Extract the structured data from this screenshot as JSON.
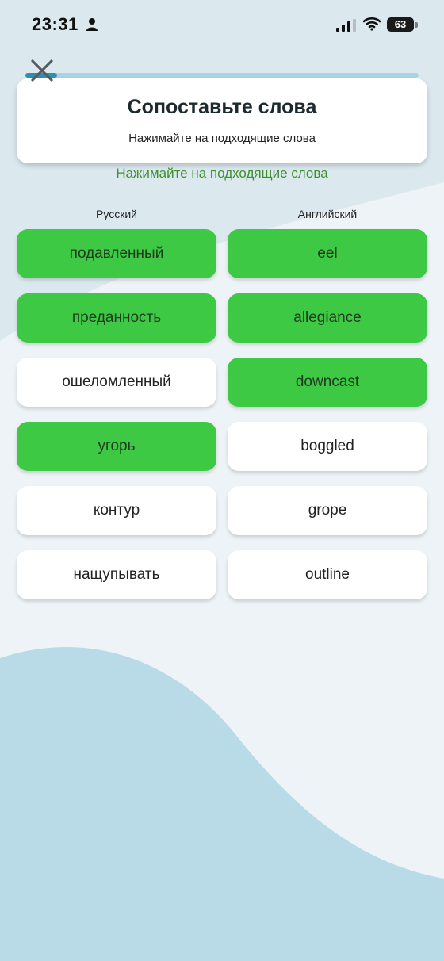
{
  "status_bar": {
    "time": "23:31",
    "battery": "63"
  },
  "progress": {
    "fraction": 0.08,
    "track_color": "#a9d3e3",
    "fill_color": "#2f8fb3"
  },
  "card": {
    "title": "Сопоставьте слова",
    "subtitle": "Нажимайте на подходящие слова"
  },
  "hint": "Нажимайте на подходящие слова",
  "columns": {
    "left_header": "Русский",
    "right_header": "Английский"
  },
  "left_tiles": [
    {
      "label": "подавленный",
      "matched": true
    },
    {
      "label": "преданность",
      "matched": true
    },
    {
      "label": "ошеломленный",
      "matched": false
    },
    {
      "label": "угорь",
      "matched": true
    },
    {
      "label": "контур",
      "matched": false
    },
    {
      "label": "нащупывать",
      "matched": false
    }
  ],
  "right_tiles": [
    {
      "label": "eel",
      "matched": true
    },
    {
      "label": "allegiance",
      "matched": true
    },
    {
      "label": "downcast",
      "matched": true
    },
    {
      "label": "boggled",
      "matched": false
    },
    {
      "label": "grope",
      "matched": false
    },
    {
      "label": "outline",
      "matched": false
    }
  ],
  "colors": {
    "matched_tile": "#3dc944",
    "hint_text": "#3f8f2f",
    "wave": "#b9dbe7"
  },
  "icons": {
    "close": "close-icon",
    "person": "person-icon",
    "signal": "cellular-signal-icon",
    "wifi": "wifi-icon",
    "battery": "battery-icon"
  }
}
